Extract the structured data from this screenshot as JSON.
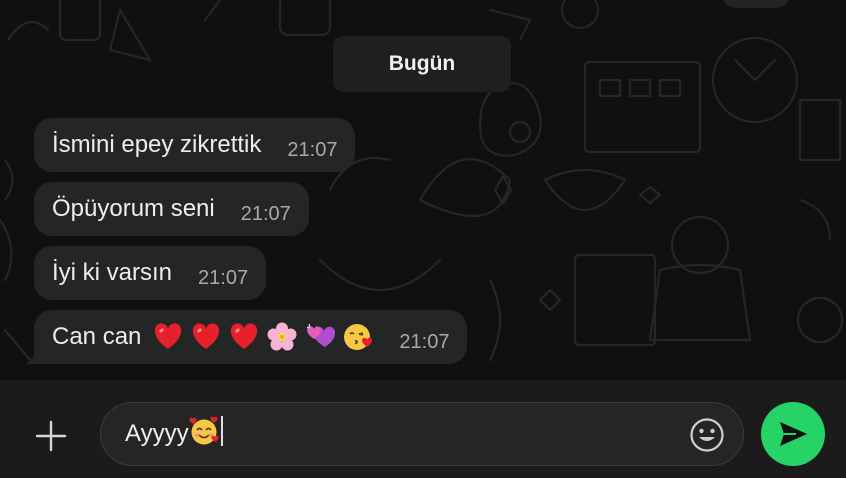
{
  "chat": {
    "date_separator": "Bugün",
    "messages": [
      {
        "text": "İsmini epey zikrettik",
        "time": "21:07"
      },
      {
        "text": "Öpüyorum seni",
        "time": "21:07"
      },
      {
        "text": "İyi ki varsın",
        "time": "21:07"
      },
      {
        "text": "Can can",
        "time": "21:07",
        "emojis": [
          "red-heart-emoji",
          "red-heart-emoji",
          "red-heart-emoji",
          "cherry-blossom-emoji",
          "two-hearts-emoji",
          "face-blowing-kiss-emoji"
        ]
      }
    ]
  },
  "composer": {
    "input_value": "Ayyyy",
    "input_emoji": "smiling-face-with-hearts-emoji",
    "icons": {
      "attach": "plus-icon",
      "emoji": "smiley-icon",
      "send": "send-icon"
    }
  },
  "colors": {
    "bubble": "#242626",
    "send_button": "#25d366",
    "background": "#101010"
  }
}
